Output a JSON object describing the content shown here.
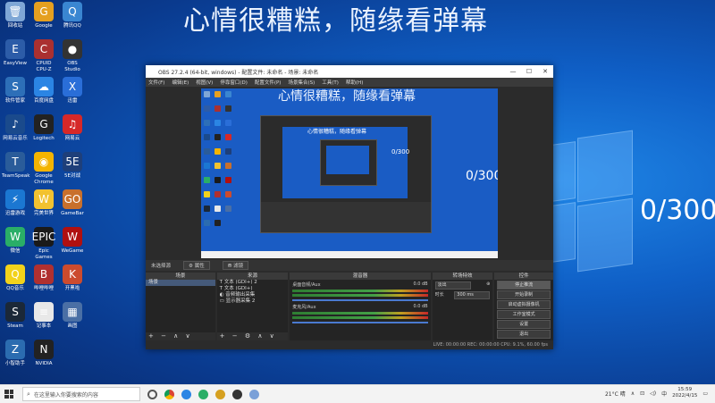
{
  "desktop": {
    "overlay_text": "心情很糟糕，随缘看弹幕",
    "counter": "0/300",
    "icons": [
      {
        "label": "回收站",
        "color": "#7fa7d6",
        "glyph": "🗑"
      },
      {
        "label": "Google",
        "color": "#e5a020",
        "glyph": "G"
      },
      {
        "label": "腾讯QQ",
        "color": "#3a86d1",
        "glyph": "Q"
      },
      {
        "label": "EasyView",
        "color": "#2c5ca8",
        "glyph": "E"
      },
      {
        "label": "CPUID CPU-Z",
        "color": "#aa3030",
        "glyph": "C"
      },
      {
        "label": "OBS Studio",
        "color": "#333333",
        "glyph": "●"
      },
      {
        "label": "软件管家",
        "color": "#2d6fb8",
        "glyph": "S"
      },
      {
        "label": "百度网盘",
        "color": "#2b85e4",
        "glyph": "☁"
      },
      {
        "label": "迅雷",
        "color": "#2a6ed8",
        "glyph": "X"
      },
      {
        "label": "网易云音乐",
        "color": "#1a4a8c",
        "glyph": "♪"
      },
      {
        "label": "Logitech",
        "color": "#222222",
        "glyph": "G"
      },
      {
        "label": "网易云",
        "color": "#d62828",
        "glyph": "♫"
      },
      {
        "label": "TeamSpeak",
        "color": "#2a5c9a",
        "glyph": "T"
      },
      {
        "label": "Google Chrome",
        "color": "#f4b400",
        "glyph": "◉"
      },
      {
        "label": "5E对战",
        "color": "#1e3f7a",
        "glyph": "5E"
      },
      {
        "label": "迅雷游戏",
        "color": "#1b77d2",
        "glyph": "⚡"
      },
      {
        "label": "完美世界",
        "color": "#f2c230",
        "glyph": "W"
      },
      {
        "label": "GameBar",
        "color": "#c8702c",
        "glyph": "GO"
      },
      {
        "label": "微信",
        "color": "#2aae67",
        "glyph": "W"
      },
      {
        "label": "Epic Games",
        "color": "#1a1a1a",
        "glyph": "EPIC"
      },
      {
        "label": "WeGame",
        "color": "#b01010",
        "glyph": "W"
      },
      {
        "label": "QQ音乐",
        "color": "#f2d21b",
        "glyph": "Q"
      },
      {
        "label": "哔哩哔哩",
        "color": "#b03030",
        "glyph": "B"
      },
      {
        "label": "开黑啦",
        "color": "#cc4b2e",
        "glyph": "K"
      },
      {
        "label": "Steam",
        "color": "#1b2838",
        "glyph": "S"
      },
      {
        "label": "记事本",
        "color": "#e8e8e8",
        "glyph": "≡"
      },
      {
        "label": "画图",
        "color": "#4a6fa5",
        "glyph": "▦"
      },
      {
        "label": "小智助手",
        "color": "#2b6cb0",
        "glyph": "Z"
      },
      {
        "label": "NVIDIA",
        "color": "#222222",
        "glyph": "N"
      }
    ]
  },
  "obs": {
    "title": "OBS 27.2.4 (64-bit, windows) - 配置文件: 未命名 - 场景: 未命名",
    "menu": [
      "文件(F)",
      "编辑(E)",
      "视图(V)",
      "停靠窗口(D)",
      "配置文件(P)",
      "场景集合(S)",
      "工具(T)",
      "帮助(H)"
    ],
    "preview_text": "心情很糟糕，随缘看弹幕",
    "preview_counter": "0/300",
    "nested_text": "心情很糟糕，随缘看弹幕",
    "nested_counter": "0/300",
    "control_bar": {
      "no_source": "未选择源",
      "props": "属性",
      "filters": "滤镜"
    },
    "scenes": {
      "title": "场景",
      "items": [
        "场景"
      ]
    },
    "sources": {
      "title": "来源",
      "items": [
        "文本 (GDI+) 2",
        "文本 (GDI+)",
        "音频输出采集",
        "显示器采集 2"
      ]
    },
    "mixer": {
      "title": "混音器",
      "channels": [
        {
          "name": "桌面音频/Aux",
          "db": "0.0 dB"
        },
        {
          "name": "麦克风/Aux",
          "db": "0.0 dB"
        }
      ]
    },
    "transitions": {
      "title": "转场特效",
      "type": "淡出",
      "duration_label": "时长",
      "duration": "300 ms"
    },
    "controls": {
      "title": "控件",
      "buttons": [
        "停止推流",
        "开始录制",
        "启动虚拟摄像机",
        "工作室模式",
        "设置",
        "退出"
      ]
    },
    "status": "LIVE: 00:00:00   REC: 00:00:00   CPU: 9.1%, 60.00 fps"
  },
  "taskbar": {
    "search_placeholder": "在这里输入你要搜索的内容",
    "weather": "21°C 晴",
    "lang": "中",
    "time": "15:59",
    "date": "2022/4/15"
  }
}
